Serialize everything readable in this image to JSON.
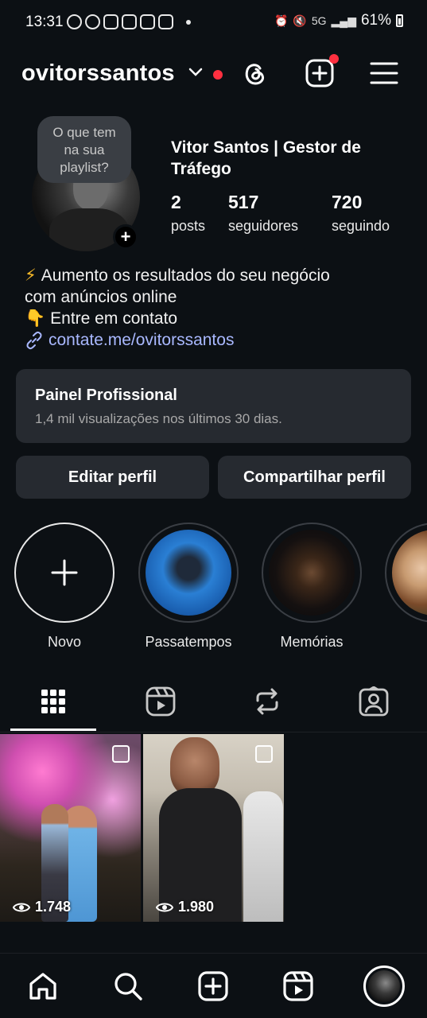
{
  "status_bar": {
    "time": "13:31",
    "battery": "61%",
    "network": "5G"
  },
  "header": {
    "username": "ovitorssantos"
  },
  "profile": {
    "note": "O que tem na sua playlist?",
    "full_name": "Vitor Santos | Gestor de Tráfego",
    "stats": [
      {
        "value": "2",
        "label": "posts"
      },
      {
        "value": "517",
        "label": "seguidores"
      },
      {
        "value": "720",
        "label": "seguindo"
      }
    ],
    "bio": [
      "Aumento os resultados do seu negócio",
      "com anúncios online",
      "Entre em contato"
    ],
    "link": "contate.me/ovitorssantos"
  },
  "panel": {
    "title": "Painel Profissional",
    "subtitle": "1,4 mil visualizações nos últimos 30 dias."
  },
  "buttons": {
    "edit": "Editar perfil",
    "share": "Compartilhar perfil"
  },
  "highlights": [
    {
      "label": "Novo"
    },
    {
      "label": "Passatempos"
    },
    {
      "label": "Memórias"
    },
    {
      "label": ""
    }
  ],
  "posts": [
    {
      "views": "1.748"
    },
    {
      "views": "1.980"
    }
  ],
  "colors": {
    "background": "#0c1014",
    "link": "#a9b8ff",
    "notification": "#ff3040",
    "button": "#262a30"
  }
}
